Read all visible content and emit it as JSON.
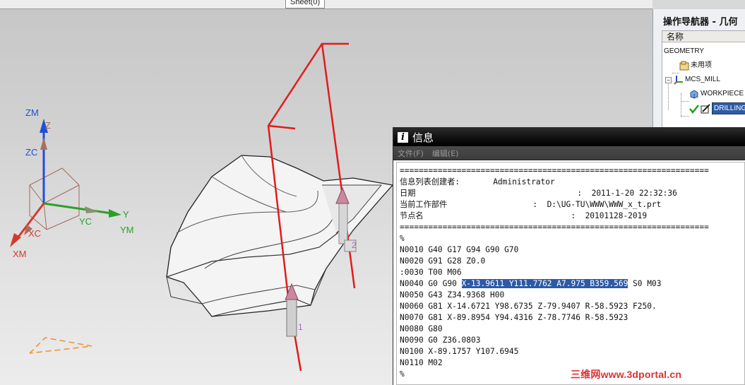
{
  "viewport": {
    "sheet_tab": "Sheet(0)",
    "axes_labels": {
      "zm": "ZM",
      "zc": "ZC",
      "z": "Z",
      "xc": "XC",
      "xm": "XM",
      "yc": "YC",
      "ym": "YM",
      "y": "Y"
    },
    "point_labels": {
      "p1": "1",
      "p2": "2"
    }
  },
  "navigator": {
    "title": "操作导航器 - 几何",
    "column_header": "名称",
    "items": [
      {
        "label": "GEOMETRY",
        "icon": "none"
      },
      {
        "label": "未用项",
        "icon": "folder-icon"
      },
      {
        "label": "MCS_MILL",
        "icon": "csys-icon"
      },
      {
        "label": "WORKPIECE",
        "icon": "workpiece-icon"
      },
      {
        "label": "DRILLING",
        "icon": "drilling-op-icon",
        "status": "checkmark-icon"
      }
    ]
  },
  "info_window": {
    "title": "信息",
    "menu": [
      "文件(F)",
      "编辑(E)"
    ],
    "lines": [
      "=================================================================",
      "信息列表创建者:       Administrator",
      "日期                                  :  2011-1-20 22:32:36",
      "当前工作部件                  :  D:\\UG-TU\\WWW\\WWW_x_t.prt",
      "节点名                               :  20101128-2019",
      "=================================================================",
      "%",
      "N0010 G40 G17 G94 G90 G70",
      "N0020 G91 G28 Z0.0",
      ":0030 T00 M06"
    ],
    "highlight_line": {
      "before": "N0040 G0 G90 ",
      "selected": "X-13.9611 Y111.7762 A7.975 B359.569",
      "after": " S0 M03"
    },
    "lines_after": [
      "N0050 G43 Z34.9368 H00",
      "N0060 G81 X-14.6721 Y98.6735 Z-79.9407 R-58.5923 F250.",
      "N0070 G81 X-89.8954 Y94.4316 Z-78.7746 R-58.5923",
      "N0080 G80",
      "N0090 G0 Z36.0803",
      "N0100 X-89.1757 Y107.6945",
      "N0110 M02",
      "%"
    ]
  },
  "watermark": "三维网www.3dportal.cn",
  "colors": {
    "toolpath": "#e21b1b",
    "z_axis": "#1f4fd8",
    "x_axis": "#d43a2c",
    "y_axis": "#2aa02a",
    "highlight": "#2d5aa7"
  }
}
